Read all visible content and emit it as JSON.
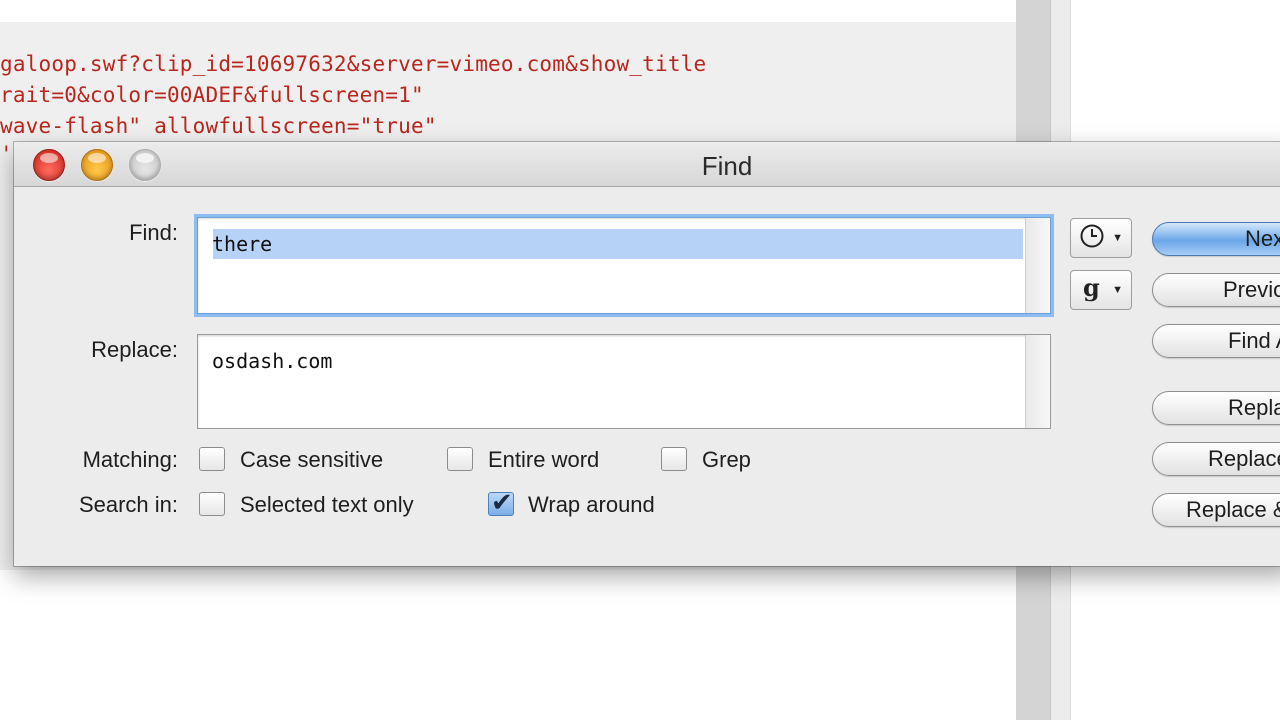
{
  "editor": {
    "lines": [
      "galoop.swf?clip_id=10697632&server=vimeo.com&show_title",
      "rait=0&color=00ADEF&fullscreen=1\"",
      "wave-flash\" allowfullscreen=\"true\"",
      "'"
    ]
  },
  "window": {
    "title": "Find"
  },
  "find": {
    "label": "Find:",
    "value": "there"
  },
  "replace": {
    "label": "Replace:",
    "value": "osdash.com"
  },
  "matching": {
    "label": "Matching:",
    "options": [
      {
        "label": "Case sensitive",
        "checked": false
      },
      {
        "label": "Entire word",
        "checked": false
      },
      {
        "label": "Grep",
        "checked": false
      }
    ]
  },
  "search_in": {
    "label": "Search in:",
    "options": [
      {
        "label": "Selected text only",
        "checked": false
      },
      {
        "label": "Wrap around",
        "checked": true
      }
    ]
  },
  "popups": {
    "history_icon": "clock-icon",
    "grep_icon": "g"
  },
  "buttons": {
    "next": "Next",
    "previous": "Previous",
    "find_all": "Find All",
    "replace": "Replace",
    "replace_all": "Replace All",
    "replace_find": "Replace & Find"
  },
  "colors": {
    "code_text": "#b8261d",
    "focus_ring": "#8cbcf0",
    "selection": "#b6d2f6",
    "default_button": "#6ba6e8"
  }
}
